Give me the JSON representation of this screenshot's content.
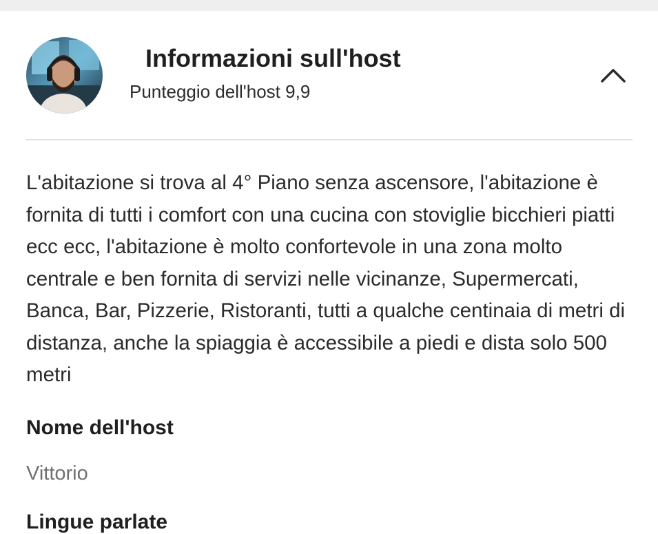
{
  "host_section": {
    "title": "Informazioni sull'host",
    "score_text": "Punteggio dell'host 9,9",
    "collapse_icon": "chevron-up-icon",
    "avatar_icon": "host-avatar"
  },
  "description": "L'abitazione si trova al 4° Piano senza ascensore, l'abitazione è fornita di tutti i comfort con una cucina con stoviglie bicchieri piatti ecc ecc, l'abitazione è molto confortevole in una zona molto centrale e ben fornita di servizi nelle vicinanze, Supermercati, Banca, Bar, Pizzerie, Ristoranti, tutti a qualche centinaia di metri di distanza, anche la spiaggia è accessibile a piedi e dista solo 500 metri",
  "host_name": {
    "label": "Nome dell'host",
    "value": "Vittorio"
  },
  "next_section": {
    "label": "Lingue parlate"
  },
  "colors": {
    "background": "#ffffff",
    "text_primary": "#1f1f1f",
    "text_secondary": "#707070",
    "divider": "#e2e2e2"
  }
}
